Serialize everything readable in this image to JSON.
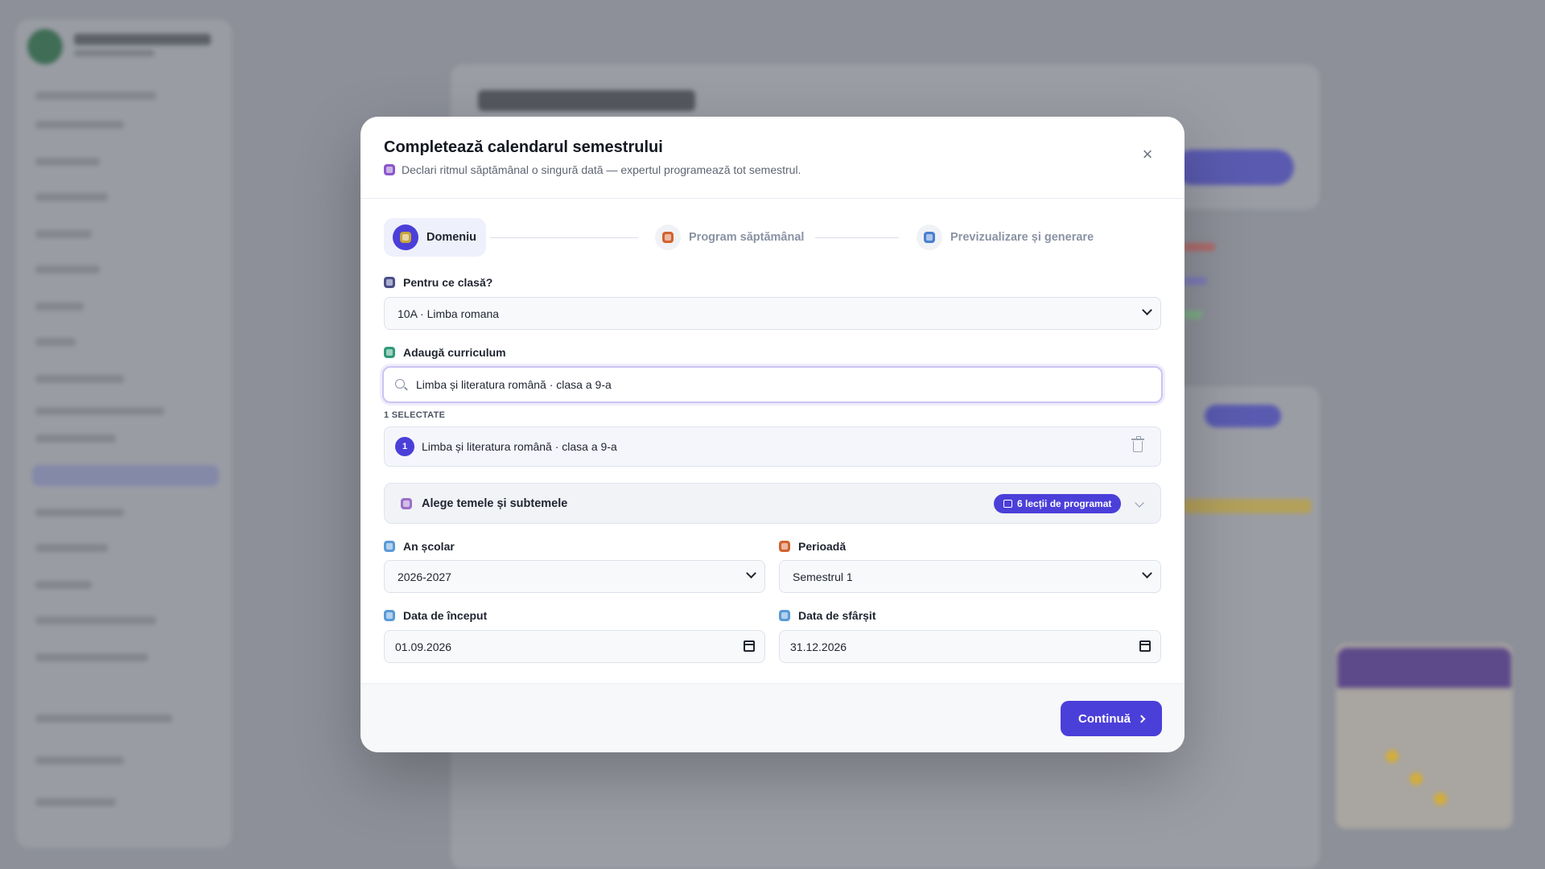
{
  "modal": {
    "title": "Completează calendarul semestrului",
    "subtitle": "Declari ritmul săptămânal o singură dată — expertul programează tot semestrul.",
    "close_label": "×"
  },
  "stepper": {
    "steps": [
      {
        "label": "Domeniu",
        "state": "active"
      },
      {
        "label": "Program săptămânal",
        "state": "idle"
      },
      {
        "label": "Previzualizare și generare",
        "state": "idle"
      }
    ]
  },
  "form": {
    "class_label": "Pentru ce clasă?",
    "class_value": "10A · Limba romana",
    "curriculum_label": "Adaugă curriculum",
    "curriculum_search_value": "Limba și literatura română · clasa a 9-a",
    "selected_count": "1 SELECTATE",
    "selected_items": [
      {
        "index": "1",
        "label": "Limba și literatura română · clasa a 9-a"
      }
    ],
    "topics_label": "Alege temele și subtemele",
    "lessons_badge": "6 lecții de programat",
    "school_year_label": "An școlar",
    "school_year_value": "2026-2027",
    "period_label": "Perioadă",
    "period_value": "Semestrul 1",
    "start_date_label": "Data de început",
    "start_date_value": "01.09.2026",
    "end_date_label": "Data de sfârșit",
    "end_date_value": "31.12.2026"
  },
  "footer": {
    "continue_label": "Continuă"
  },
  "colors": {
    "accent": "#4b3fd9",
    "overlay": "#8d9099"
  }
}
